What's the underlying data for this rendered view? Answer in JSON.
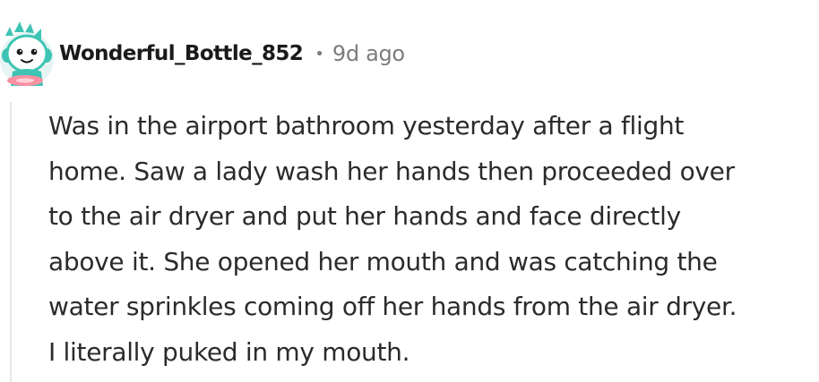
{
  "comment": {
    "author": "Wonderful_Bottle_852",
    "separator": "•",
    "age": "9d ago",
    "avatar_icon": "snoo-avatar-icon",
    "text": "Was in the airport bathroom yesterday after a flight\nhome. Saw a lady wash her hands then proceeded over\nto the air dryer and put her hands and face directly\nabove it. She opened her mouth and was catching the\nwater sprinkles coming off her hands from the air dryer.\nI literally puked in my mouth."
  },
  "colors": {
    "username": "#1a1a1b",
    "meta": "#7c7c7c",
    "body_text": "#2b2b2b",
    "thread_line": "#e8e8e8",
    "avatar_accent": "#3fc4b4",
    "avatar_pink": "#ff8fa3"
  }
}
